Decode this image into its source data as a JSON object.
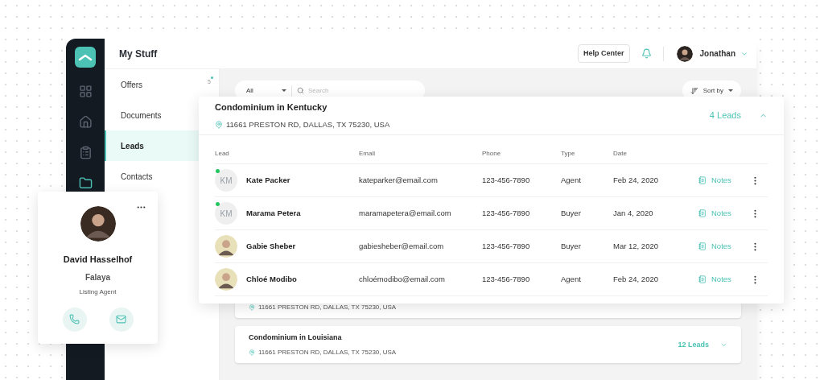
{
  "rail": [
    {
      "kind": "logo",
      "selected": false
    },
    {
      "kind": "grid",
      "selected": false
    },
    {
      "kind": "home",
      "selected": false
    },
    {
      "kind": "clipboard",
      "selected": false
    },
    {
      "kind": "folder",
      "selected": true
    }
  ],
  "section_title": "My Stuff",
  "menu": [
    {
      "label": "Offers",
      "badge": "5",
      "selected": false
    },
    {
      "label": "Documents",
      "selected": false
    },
    {
      "label": "Leads",
      "selected": true
    },
    {
      "label": "Contacts",
      "selected": false
    }
  ],
  "header": {
    "help": "Help Center",
    "user": "Jonathan"
  },
  "filter": {
    "scope": "All",
    "placeholder": "Search",
    "sort": "Sort by"
  },
  "expanded_property": {
    "title": "Condominium in Kentucky",
    "address": "11661 PRESTON RD, DALLAS, TX 75230, USA",
    "leads": "4 Leads",
    "expanded": true,
    "columns": [
      "Lead",
      "Email",
      "Phone",
      "Type",
      "Date"
    ],
    "rows": [
      {
        "avatar": {
          "kind": "initials",
          "initials": "KM"
        },
        "online": true,
        "name": "Kate Packer",
        "email": "kateparker@email.com",
        "phone": "123-456-7890",
        "type": "Agent",
        "date": "Feb 24, 2020",
        "notes": "Notes"
      },
      {
        "avatar": {
          "kind": "initials",
          "initials": "KM"
        },
        "online": true,
        "name": "Marama Petera",
        "email": "maramapetera@email.com",
        "phone": "123-456-7890",
        "type": "Buyer",
        "date": "Jan 4, 2020",
        "notes": "Notes"
      },
      {
        "avatar": {
          "kind": "photo"
        },
        "online": false,
        "name": "Gabie Sheber",
        "email": "gabiesheber@email.com",
        "phone": "123-456-7890",
        "type": "Buyer",
        "date": "Mar 12, 2020",
        "notes": "Notes"
      },
      {
        "avatar": {
          "kind": "photo"
        },
        "online": false,
        "name": "Chloé Modibo",
        "email": "chloémodibo@email.com",
        "phone": "123-456-7890",
        "type": "Agent",
        "date": "Feb 24, 2020",
        "notes": "Notes"
      }
    ]
  },
  "properties": [
    {
      "address": "11661 PRESTON RD, DALLAS, TX 75230, USA"
    },
    {
      "title": "Condominium in Louisiana",
      "address": "11661 PRESTON RD, DALLAS, TX 75230, USA",
      "leads": "12 Leads",
      "expanded": false
    }
  ],
  "contact_card": {
    "name": "David Hasselhof",
    "company": "Falaya",
    "role": "Listing Agent"
  }
}
